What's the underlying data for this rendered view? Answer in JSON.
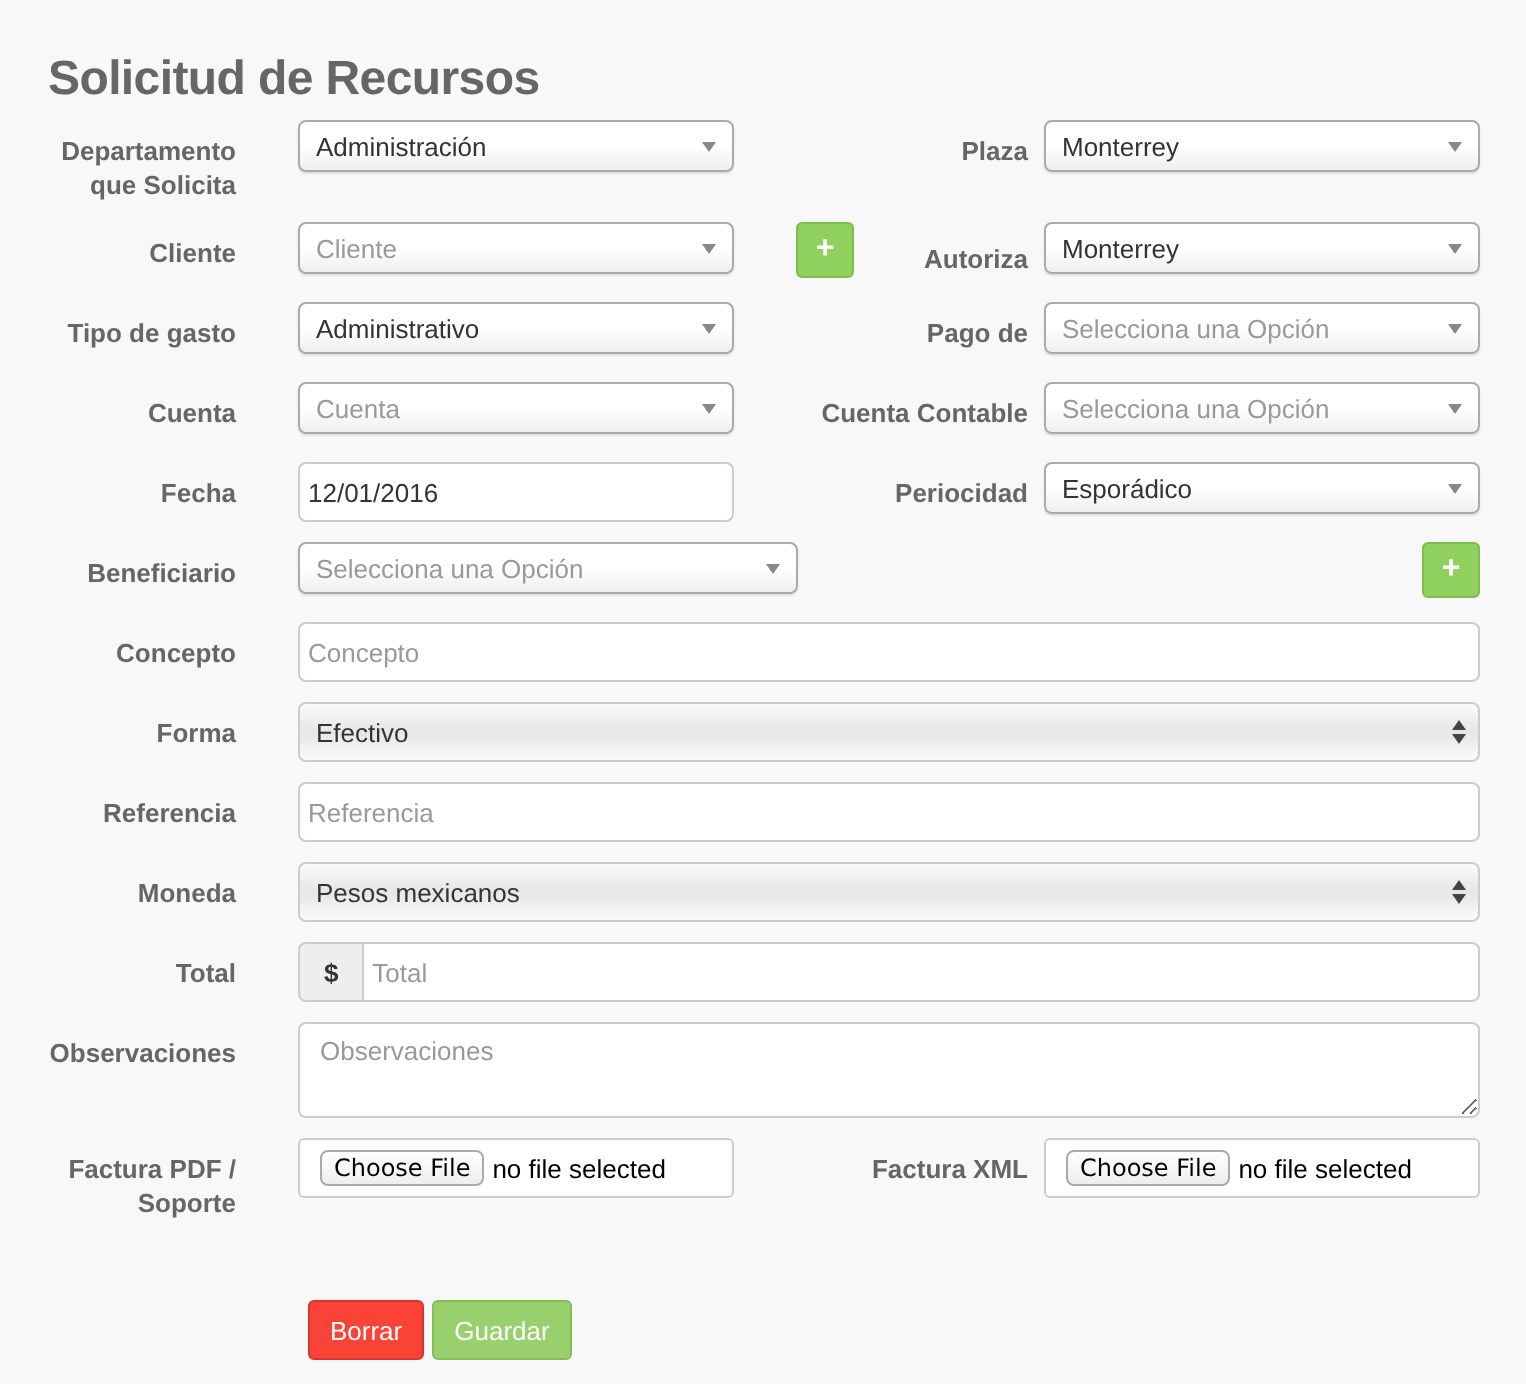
{
  "title": "Solicitud de Recursos",
  "rows": [
    {
      "kind": "pair",
      "left": {
        "label": "Departamento que Solicita",
        "field": {
          "kind": "select",
          "value": "Administración"
        }
      },
      "right": {
        "label": "Plaza",
        "field": {
          "kind": "select",
          "value": "Monterrey"
        }
      }
    },
    {
      "kind": "pair",
      "left": {
        "label": "Cliente",
        "field": {
          "kind": "select",
          "placeholder": "Cliente"
        }
      },
      "add_button": "+",
      "right": {
        "label": "Autoriza",
        "field": {
          "kind": "select",
          "value": "Monterrey"
        }
      }
    },
    {
      "kind": "pair",
      "left": {
        "label": "Tipo de gasto",
        "field": {
          "kind": "select",
          "value": "Administrativo"
        }
      },
      "right": {
        "label": "Pago de",
        "field": {
          "kind": "select",
          "placeholder": "Selecciona una Opción"
        }
      }
    },
    {
      "kind": "pair",
      "left": {
        "label": "Cuenta",
        "field": {
          "kind": "select",
          "placeholder": "Cuenta"
        }
      },
      "right": {
        "label": "Cuenta Contable",
        "field": {
          "kind": "select",
          "placeholder": "Selecciona una Opción"
        }
      }
    },
    {
      "kind": "pair",
      "left": {
        "label": "Fecha",
        "field": {
          "kind": "input",
          "value": "12/01/2016"
        }
      },
      "right": {
        "label": "Periocidad",
        "field": {
          "kind": "select",
          "value": "Esporádico"
        }
      }
    },
    {
      "kind": "select-add",
      "label": "Beneficiario",
      "field": {
        "kind": "select",
        "placeholder": "Selecciona una Opción"
      },
      "add_button": "+"
    },
    {
      "kind": "wide",
      "label": "Concepto",
      "field": {
        "kind": "input",
        "placeholder": "Concepto"
      }
    },
    {
      "kind": "wide",
      "label": "Forma",
      "field": {
        "kind": "native-select",
        "value": "Efectivo"
      }
    },
    {
      "kind": "wide",
      "label": "Referencia",
      "field": {
        "kind": "input",
        "placeholder": "Referencia"
      }
    },
    {
      "kind": "wide",
      "label": "Moneda",
      "field": {
        "kind": "native-select",
        "value": "Pesos mexicanos"
      }
    },
    {
      "kind": "wide",
      "label": "Total",
      "field": {
        "kind": "money",
        "prefix": "$",
        "placeholder": "Total"
      }
    },
    {
      "kind": "wide",
      "label": "Observaciones",
      "field": {
        "kind": "textarea",
        "placeholder": "Observaciones"
      }
    },
    {
      "kind": "pair",
      "left": {
        "label": "Factura PDF / Soporte",
        "field": {
          "kind": "file",
          "button": "Choose File",
          "status": "no file selected"
        }
      },
      "right": {
        "label": "Factura XML",
        "field": {
          "kind": "file",
          "button": "Choose File",
          "status": "no file selected"
        }
      }
    }
  ],
  "buttons": [
    {
      "label": "Borrar",
      "kind": "danger"
    },
    {
      "label": "Guardar",
      "kind": "success"
    }
  ]
}
